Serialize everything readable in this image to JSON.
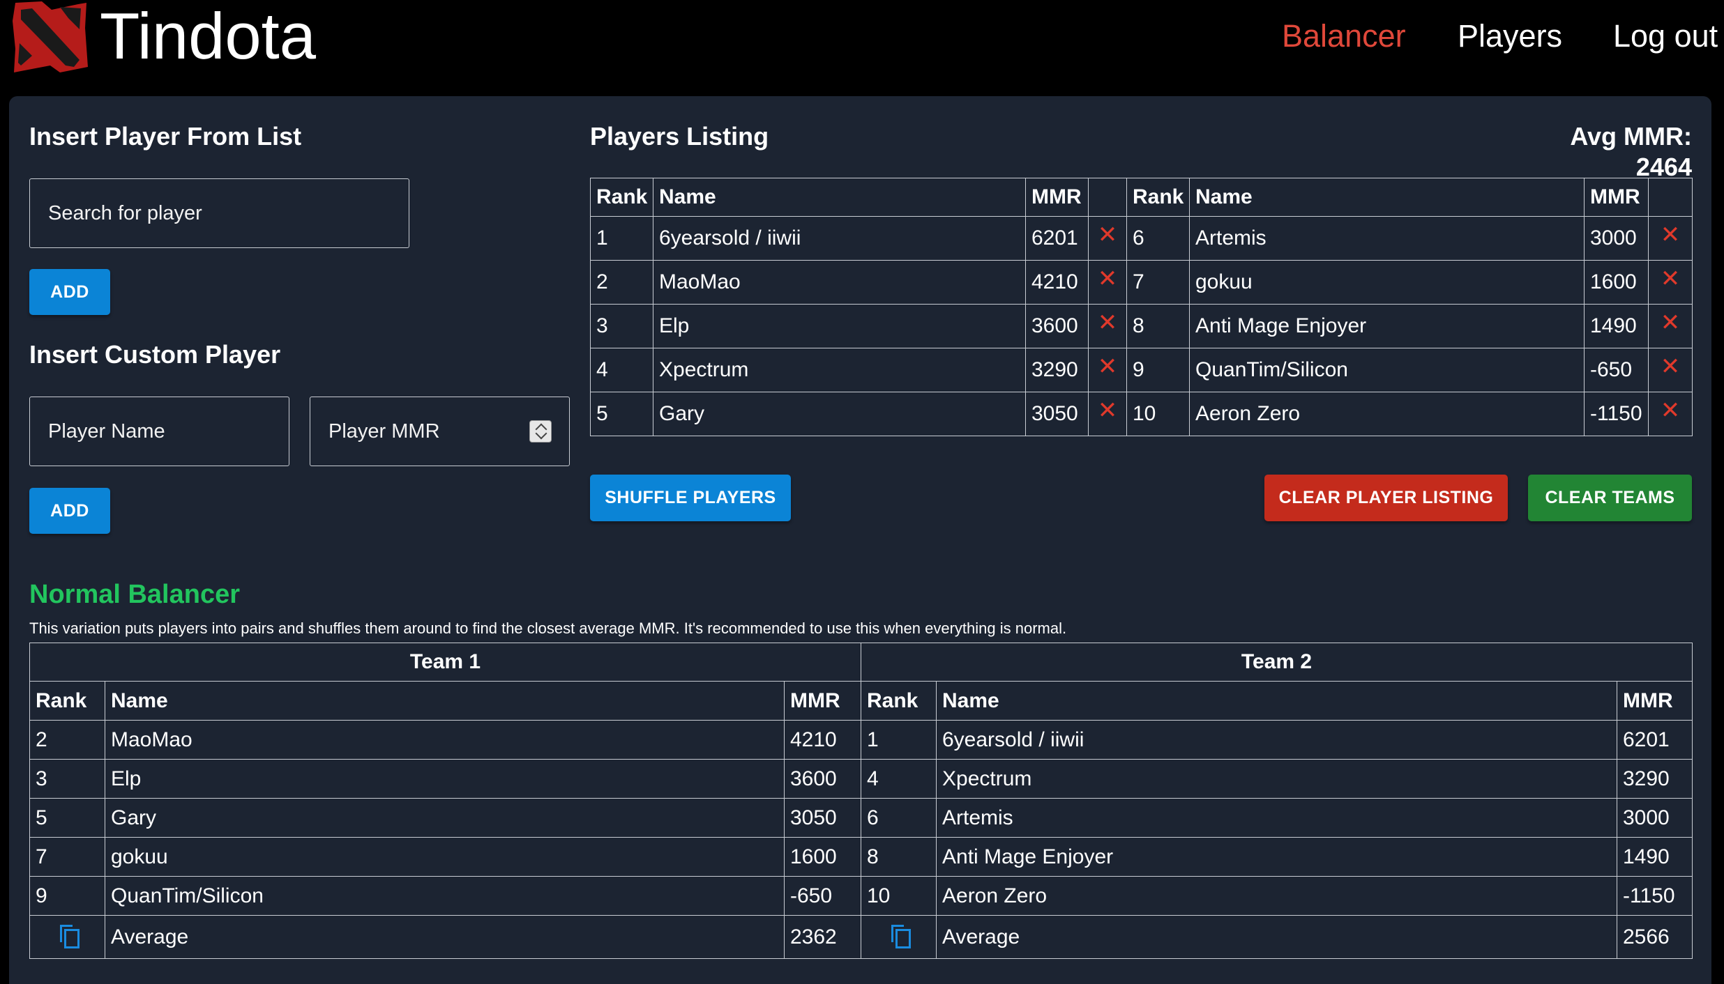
{
  "header": {
    "brand": "Tindota",
    "nav": [
      "Balancer",
      "Players",
      "Log out"
    ],
    "active_nav": "Balancer",
    "accent_color": "#e0483a",
    "logo_icon": "dota-logo-icon"
  },
  "insert_from_list": {
    "title": "Insert Player From List",
    "search_placeholder": "Search for player",
    "add_label": "ADD"
  },
  "insert_custom": {
    "title": "Insert Custom Player",
    "name_placeholder": "Player Name",
    "mmr_placeholder": "Player MMR",
    "add_label": "ADD"
  },
  "listing": {
    "title": "Players Listing",
    "avg_mmr": "Avg MMR: 2464",
    "headers": {
      "rank": "Rank",
      "name": "Name",
      "mmr": "MMR"
    },
    "remove_icon": "close-icon",
    "left": [
      {
        "rank": "1",
        "name": "6yearsold / iiwii",
        "mmr": "6201"
      },
      {
        "rank": "2",
        "name": "MaoMao",
        "mmr": "4210"
      },
      {
        "rank": "3",
        "name": "Elp",
        "mmr": "3600"
      },
      {
        "rank": "4",
        "name": "Xpectrum",
        "mmr": "3290"
      },
      {
        "rank": "5",
        "name": "Gary",
        "mmr": "3050"
      }
    ],
    "right": [
      {
        "rank": "6",
        "name": "Artemis",
        "mmr": "3000"
      },
      {
        "rank": "7",
        "name": "gokuu",
        "mmr": "1600"
      },
      {
        "rank": "8",
        "name": "Anti Mage Enjoyer",
        "mmr": "1490"
      },
      {
        "rank": "9",
        "name": "QuanTim/Silicon",
        "mmr": "-650"
      },
      {
        "rank": "10",
        "name": "Aeron Zero",
        "mmr": "-1150"
      }
    ],
    "shuffle_label": "SHUFFLE PLAYERS",
    "clear_listing_label": "CLEAR PLAYER LISTING",
    "clear_teams_label": "CLEAR TEAMS"
  },
  "balancer": {
    "title": "Normal Balancer",
    "description": "This variation puts players into pairs and shuffles them around to find the closest average MMR. It's recommended to use this when everything is normal.",
    "team1": {
      "title": "Team 1",
      "players": [
        {
          "rank": "2",
          "name": "MaoMao",
          "mmr": "4210"
        },
        {
          "rank": "3",
          "name": "Elp",
          "mmr": "3600"
        },
        {
          "rank": "5",
          "name": "Gary",
          "mmr": "3050"
        },
        {
          "rank": "7",
          "name": "gokuu",
          "mmr": "1600"
        },
        {
          "rank": "9",
          "name": "QuanTim/Silicon",
          "mmr": "-650"
        }
      ],
      "average_label": "Average",
      "average": "2362"
    },
    "team2": {
      "title": "Team 2",
      "players": [
        {
          "rank": "1",
          "name": "6yearsold / iiwii",
          "mmr": "6201"
        },
        {
          "rank": "4",
          "name": "Xpectrum",
          "mmr": "3290"
        },
        {
          "rank": "6",
          "name": "Artemis",
          "mmr": "3000"
        },
        {
          "rank": "8",
          "name": "Anti Mage Enjoyer",
          "mmr": "1490"
        },
        {
          "rank": "10",
          "name": "Aeron Zero",
          "mmr": "-1150"
        }
      ],
      "average_label": "Average",
      "average": "2566"
    },
    "copy_icon": "copy-icon"
  }
}
